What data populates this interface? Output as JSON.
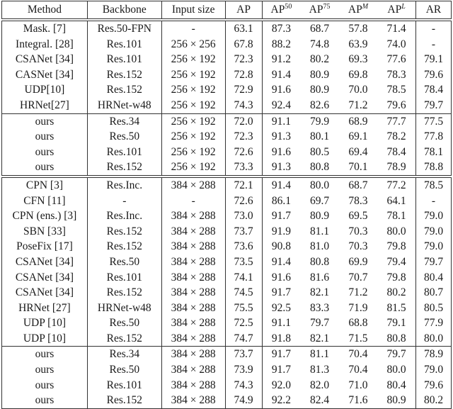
{
  "table": {
    "headers": {
      "method": "Method",
      "backbone": "Backbone",
      "input_size": "Input size",
      "ap": "AP",
      "ap50_base": "AP",
      "ap50_sup": "50",
      "ap75_base": "AP",
      "ap75_sup": "75",
      "apm_base": "AP",
      "apm_sup": "M",
      "apl_base": "AP",
      "apl_sup": "L",
      "ar": "AR"
    },
    "groups": [
      {
        "baselines": [
          {
            "method": "Mask. [7]",
            "backbone": "Res.50-FPN",
            "input": "-",
            "ap": "63.1",
            "ap50": "87.3",
            "ap75": "68.7",
            "apm": "57.8",
            "apl": "71.4",
            "ar": "-",
            "bold": false
          },
          {
            "method": "Integral. [28]",
            "backbone": "Res.101",
            "input": "256 × 256",
            "ap": "67.8",
            "ap50": "88.2",
            "ap75": "74.8",
            "apm": "63.9",
            "apl": "74.0",
            "ar": "-",
            "bold": false
          },
          {
            "method": "CSANet [34]",
            "backbone": "Res.101",
            "input": "256 × 192",
            "ap": "72.3",
            "ap50": "91.2",
            "ap75": "80.2",
            "apm": "69.3",
            "apl": "77.6",
            "ar": "79.1",
            "bold": false
          },
          {
            "method": "CASNet [34]",
            "backbone": "Res.152",
            "input": "256 × 192",
            "ap": "72.8",
            "ap50": "91.4",
            "ap75": "80.9",
            "apm": "69.8",
            "apl": "78.3",
            "ar": "79.6",
            "bold": false
          },
          {
            "method": "UDP[10]",
            "backbone": "Res.152",
            "input": "256 × 192",
            "ap": "72.9",
            "ap50": "91.6",
            "ap75": "80.9",
            "apm": "70.0",
            "apl": "78.5",
            "ar": "78.4",
            "bold": false
          },
          {
            "method": "HRNet[27]",
            "backbone": "HRNet-w48",
            "input": "256 × 192",
            "ap": "74.3",
            "ap50": "92.4",
            "ap75": "82.6",
            "apm": "71.2",
            "apl": "79.6",
            "ar": "79.7",
            "bold": true
          }
        ],
        "ours": [
          {
            "method": "ours",
            "backbone": "Res.34",
            "input": "256 × 192",
            "ap": "72.0",
            "ap50": "91.1",
            "ap75": "79.9",
            "apm": "68.9",
            "apl": "77.7",
            "ar": "77.5"
          },
          {
            "method": "ours",
            "backbone": "Res.50",
            "input": "256 × 192",
            "ap": "72.3",
            "ap50": "91.3",
            "ap75": "80.1",
            "apm": "69.1",
            "apl": "78.2",
            "ar": "77.8"
          },
          {
            "method": "ours",
            "backbone": "Res.101",
            "input": "256 × 192",
            "ap": "72.6",
            "ap50": "91.6",
            "ap75": "80.5",
            "apm": "69.4",
            "apl": "78.4",
            "ar": "78.1"
          },
          {
            "method": "ours",
            "backbone": "Res.152",
            "input": "256 × 192",
            "ap": "73.3",
            "ap50": "91.3",
            "ap75": "80.8",
            "apm": "70.1",
            "apl": "78.9",
            "ar": "78.8"
          }
        ]
      },
      {
        "baselines": [
          {
            "method": "CPN [3]",
            "backbone": "Res.Inc.",
            "input": "384 × 288",
            "ap": "72.1",
            "ap50": "91.4",
            "ap75": "80.0",
            "apm": "68.7",
            "apl": "77.2",
            "ar": "78.5",
            "bold": false
          },
          {
            "method": "CFN [11]",
            "backbone": "-",
            "input": "-",
            "ap": "72.6",
            "ap50": "86.1",
            "ap75": "69.7",
            "apm": "78.3",
            "apl": "64.1",
            "ar": "-",
            "bold": false
          },
          {
            "method": "CPN (ens.) [3]",
            "backbone": "Res.Inc.",
            "input": "384 × 288",
            "ap": "73.0",
            "ap50": "91.7",
            "ap75": "80.9",
            "apm": "69.5",
            "apl": "78.1",
            "ar": "79.0",
            "bold": false
          },
          {
            "method": "SBN [33]",
            "backbone": "Res.152",
            "input": "384 × 288",
            "ap": "73.7",
            "ap50": "91.9",
            "ap75": "81.1",
            "apm": "70.3",
            "apl": "80.0",
            "ar": "79.0",
            "bold": false
          },
          {
            "method": "PoseFix [17]",
            "backbone": "Res.152",
            "input": "384 × 288",
            "ap": "73.6",
            "ap50": "90.8",
            "ap75": "81.0",
            "apm": "70.3",
            "apl": "79.8",
            "ar": "79.0",
            "bold": false
          },
          {
            "method": "CSANet [34]",
            "backbone": "Res.50",
            "input": "384 × 288",
            "ap": "73.5",
            "ap50": "91.4",
            "ap75": "80.8",
            "apm": "69.9",
            "apl": "79.4",
            "ar": "79.7",
            "bold": false
          },
          {
            "method": "CSANet [34]",
            "backbone": "Res.101",
            "input": "384 × 288",
            "ap": "74.1",
            "ap50": "91.6",
            "ap75": "81.6",
            "apm": "70.7",
            "apl": "79.8",
            "ar": "80.4",
            "bold": false
          },
          {
            "method": "CSANet [34]",
            "backbone": "Res.152",
            "input": "384 × 288",
            "ap": "74.5",
            "ap50": "91.7",
            "ap75": "82.1",
            "apm": "71.2",
            "apl": "80.2",
            "ar": "80.7",
            "bold": false
          },
          {
            "method": "HRNet [27]",
            "backbone": "HRNet-w48",
            "input": "384 × 288",
            "ap": "75.5",
            "ap50": "92.5",
            "ap75": "83.3",
            "apm": "71.9",
            "apl": "81.5",
            "ar": "80.5",
            "bold": true
          },
          {
            "method": "UDP [10]",
            "backbone": "Res.50",
            "input": "384 × 288",
            "ap": "72.5",
            "ap50": "91.1",
            "ap75": "79.7",
            "apm": "68.8",
            "apl": "79.1",
            "ar": "77.9",
            "bold": false
          },
          {
            "method": "UDP [10]",
            "backbone": "Res.152",
            "input": "384 × 288",
            "ap": "74.7",
            "ap50": "91.8",
            "ap75": "82.1",
            "apm": "71.5",
            "apl": "80.8",
            "ar": "80.0",
            "bold": false
          }
        ],
        "ours": [
          {
            "method": "ours",
            "backbone": "Res.34",
            "input": "384 × 288",
            "ap": "73.7",
            "ap50": "91.7",
            "ap75": "81.1",
            "apm": "70.4",
            "apl": "79.7",
            "ar": "78.9"
          },
          {
            "method": "ours",
            "backbone": "Res.50",
            "input": "384 × 288",
            "ap": "73.9",
            "ap50": "91.7",
            "ap75": "81.3",
            "apm": "70.4",
            "apl": "80.0",
            "ar": "79.0"
          },
          {
            "method": "ours",
            "backbone": "Res.101",
            "input": "384 × 288",
            "ap": "74.3",
            "ap50": "92.0",
            "ap75": "82.0",
            "apm": "71.0",
            "apl": "80.4",
            "ar": "79.6"
          },
          {
            "method": "ours",
            "backbone": "Res.152",
            "input": "384 × 288",
            "ap": "74.9",
            "ap50": "92.2",
            "ap75": "82.4",
            "apm": "71.6",
            "apl": "80.9",
            "ar": "80.2"
          }
        ]
      }
    ]
  }
}
